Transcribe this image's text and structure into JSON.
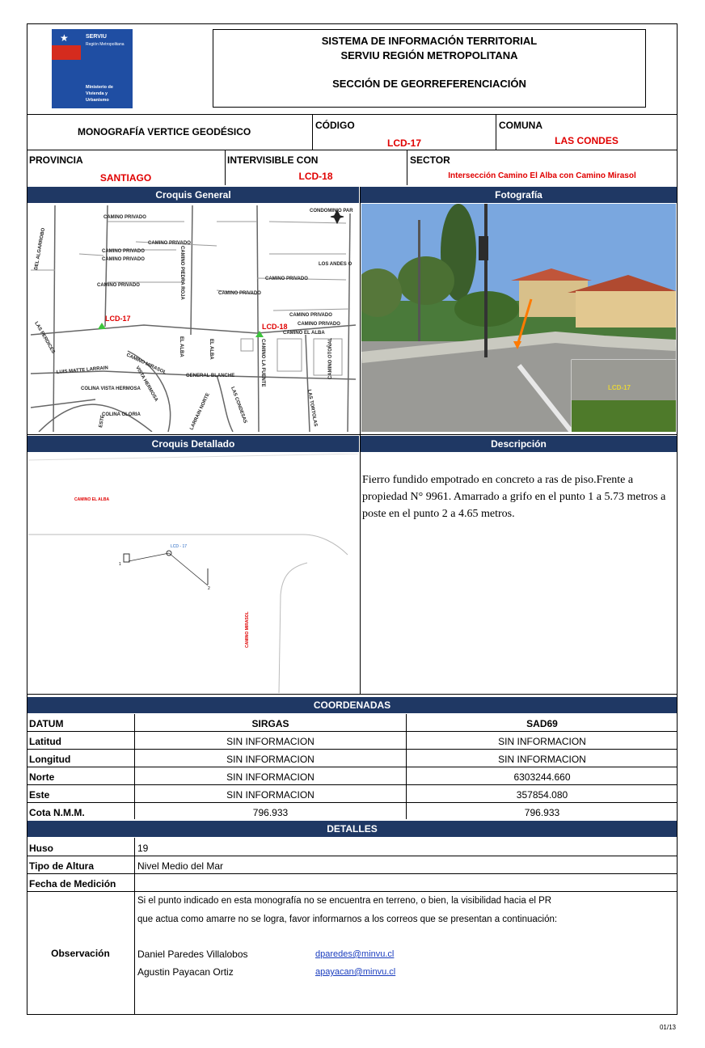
{
  "header": {
    "logo_title": "SERVIU",
    "logo_subtitle": "Región Metropolitana",
    "logo_ministry": "Ministerio de Vivienda y Urbanismo",
    "line1": "SISTEMA DE INFORMACIÓN TERRITORIAL",
    "line2": "SERVIU REGIÓN METROPOLITANA",
    "line3": "SECCIÓN  DE GEORREFERENCIACIÓN"
  },
  "info": {
    "doc_title": "MONOGRAFÍA VERTICE GEODÉSICO",
    "codigo_label": "CÓDIGO",
    "codigo_value": "LCD-17",
    "comuna_label": "COMUNA",
    "comuna_value": "LAS CONDES",
    "provincia_label": "PROVINCIA",
    "provincia_value": "SANTIAGO",
    "intervisible_label": "INTERVISIBLE CON",
    "intervisible_value": "LCD-18",
    "sector_label": "SECTOR",
    "sector_value": "Intersección Camino El Alba con Camino Mirasol"
  },
  "sections": {
    "croquis_general": "Croquis General",
    "fotografia": "Fotografía",
    "croquis_detallado": "Croquis Detallado",
    "descripcion": "Descripción",
    "coordenadas": "COORDENADAS",
    "detalles": "DETALLES"
  },
  "map": {
    "streets": [
      "CAMINO PRIVADO",
      "CAMINO PRIVADO",
      "CAMINO PRIVADO",
      "CAMINO PRIVADO",
      "CAMINO PRIVADO",
      "CAMINO PRIVADO",
      "CAMINO PRIVADO",
      "CAMINO PRIVADO",
      "CAMINO PRIVADO",
      "CONDOMINIO PAR",
      "LOS ANDES O",
      "CAMINO EL ALBA",
      "CAMINO MIRASOL",
      "GENERAL BLANCHE",
      "LUIS MATTE LARRAIN",
      "COLINA VISTA HERMOSA",
      "COLINA GLORIA",
      "VISTA HERMOSA",
      "CAMINO PIEDRA ROJA",
      "CAMINO LA FUENTE",
      "CAMINO OTOÑAL",
      "EL ALBA",
      "EL ALBA",
      "LAS CONDESAS",
      "LAS TORTOLAS",
      "DEL ALGARROBO",
      "LAS PERDICES",
      "ESTE",
      "LARRAIN NORTE"
    ],
    "marker1": "LCD-17",
    "marker2": "LCD-18",
    "photo_tag": "LCD-17"
  },
  "detail": {
    "street_top": "CAMINO EL ALBA",
    "street_side": "CAMINO MIRASOL",
    "point_label": "LCD - 17",
    "p1": "1",
    "p2": "2"
  },
  "description": "Fierro fundido empotrado en concreto a ras de piso.Frente a propiedad N° 9961. Amarrado a grifo en el punto 1 a 5.73 metros a poste en el punto 2 a 4.65 metros.",
  "coords": {
    "head": [
      "DATUM",
      "SIRGAS",
      "SAD69"
    ],
    "rows": [
      {
        "label": "Latitud",
        "sirgas": "SIN INFORMACION",
        "sad69": "SIN INFORMACION"
      },
      {
        "label": "Longitud",
        "sirgas": "SIN INFORMACION",
        "sad69": "SIN INFORMACION"
      },
      {
        "label": "Norte",
        "sirgas": "SIN INFORMACION",
        "sad69": "6303244.660"
      },
      {
        "label": "Este",
        "sirgas": "SIN INFORMACION",
        "sad69": "357854.080"
      },
      {
        "label": "Cota N.M.M.",
        "sirgas": "796.933",
        "sad69": "796.933"
      }
    ]
  },
  "details": {
    "huso_label": "Huso",
    "huso_value": "19",
    "altura_label": "Tipo de Altura",
    "altura_value": "Nivel Medio del Mar",
    "fecha_label": "Fecha de Medición",
    "fecha_value": "",
    "obs_label": "Observación",
    "obs_line1": "Si el punto indicado en esta monografía no se encuentra en terreno, o bien, la visibilidad hacia el PR",
    "obs_line2": "que actua como amarre no se logra, favor informarnos a los correos que se presentan a continuación:",
    "contact1_name": "Daniel Paredes Villalobos",
    "contact1_email": "dparedes@minvu.cl",
    "contact2_name": "Agustin Payacan Ortiz",
    "contact2_email": "apayacan@minvu.cl"
  },
  "footer": {
    "page": "01/13"
  },
  "colors": {
    "header_bar": "#1f3864",
    "accent_red": "#e00000",
    "logo_blue": "#1f4ea3",
    "logo_red": "#d52b1e"
  }
}
